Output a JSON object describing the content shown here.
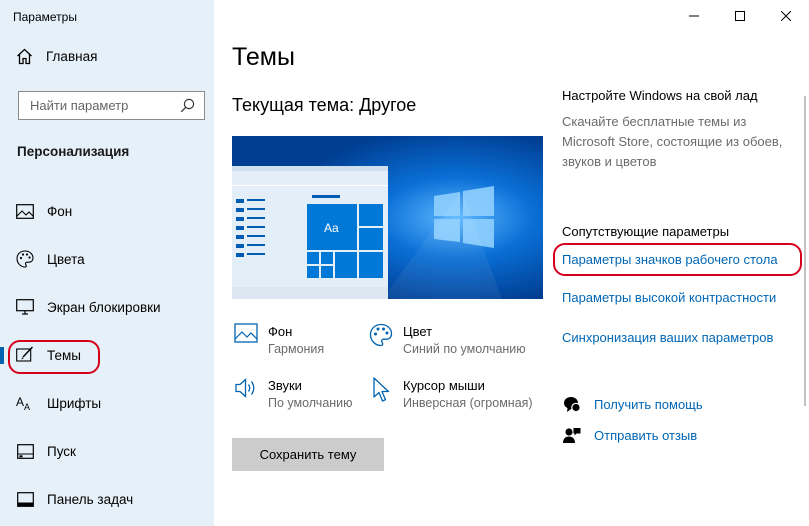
{
  "window": {
    "title": "Параметры",
    "minimize_icon": "minimize-icon",
    "maximize_icon": "maximize-icon",
    "close_icon": "close-icon"
  },
  "sidebar": {
    "home_label": "Главная",
    "search_placeholder": "Найти параметр",
    "section_title": "Персонализация",
    "items": [
      {
        "label": "Фон",
        "icon": "picture-icon"
      },
      {
        "label": "Цвета",
        "icon": "palette-icon"
      },
      {
        "label": "Экран блокировки",
        "icon": "monitor-icon"
      },
      {
        "label": "Темы",
        "icon": "brush-icon",
        "selected": true
      },
      {
        "label": "Шрифты",
        "icon": "font-icon"
      },
      {
        "label": "Пуск",
        "icon": "start-icon"
      },
      {
        "label": "Панель задач",
        "icon": "taskbar-icon"
      }
    ]
  },
  "main": {
    "title": "Темы",
    "current_theme": "Текущая тема: Другое",
    "props": [
      {
        "title": "Фон",
        "subtitle": "Гармония",
        "icon": "picture-icon"
      },
      {
        "title": "Цвет",
        "subtitle": "Синий по умолчанию",
        "icon": "palette-icon"
      },
      {
        "title": "Звуки",
        "subtitle": "По умолчанию",
        "icon": "speaker-icon"
      },
      {
        "title": "Курсор мыши",
        "subtitle": "Инверсная (огромная)",
        "icon": "cursor-icon"
      }
    ],
    "save_button": "Сохранить тему",
    "preview_tile_text": "Aa"
  },
  "right": {
    "customize_title": "Настройте Windows на свой лад",
    "customize_desc": "Скачайте бесплатные темы из Microsoft Store, состоящие из обоев, звуков и цветов",
    "related_title": "Сопутствующие параметры",
    "links": [
      "Параметры значков рабочего стола",
      "Параметры высокой контрастности",
      "Синхронизация ваших параметров"
    ],
    "help_label": "Получить помощь",
    "feedback_label": "Отправить отзыв"
  },
  "colors": {
    "sidebar_bg": "#e6f0f8",
    "accent": "#0063b1",
    "link": "#0066b4",
    "highlight_oval": "#d6001c"
  }
}
